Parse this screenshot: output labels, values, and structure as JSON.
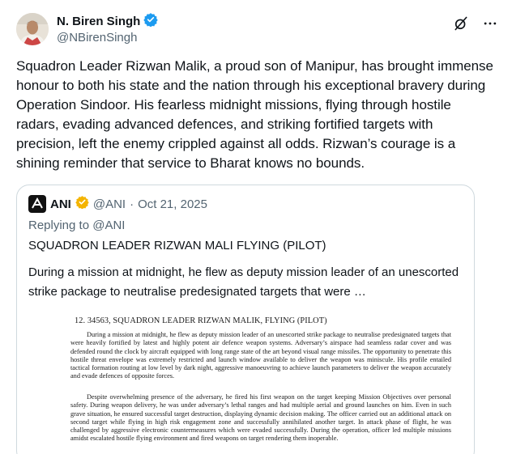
{
  "author": {
    "display_name": "N. Biren Singh",
    "handle": "@NBirenSingh",
    "verified_color": "#1d9bf0"
  },
  "actions": {
    "grok_icon": "grok-icon",
    "more_icon": "more-icon"
  },
  "tweet": {
    "text": "Squadron Leader Rizwan Malik, a proud son of Manipur, has brought immense honour to both his state and the nation through his exceptional bravery during Operation Sindoor. His fearless midnight missions, flying through hostile radars, evading advanced defences, and striking fortified targets with precision, left the enemy crippled against all odds. Rizwan’s courage is a shining reminder that service to Bharat knows no bounds."
  },
  "quote": {
    "name": "ANI",
    "handle": "@ANI",
    "separator": "·",
    "date": "Oct 21, 2025",
    "verified_color": "#f4b400",
    "replying_prefix": "Replying to ",
    "replying_handle": "@ANI",
    "title": "SQUADRON LEADER RIZWAN MALI FLYING (PILOT)",
    "body": "During a mission at midnight, he flew as deputy mission leader of an unescorted strike package to neutralise predesignated targets that were …",
    "document": {
      "heading": "12.  34563, SQUADRON LEADER RIZWAN MALIK, FLYING (PILOT)",
      "paragraph1": "During a mission at midnight, he flew as deputy mission leader of an unescorted strike package to neutralise predesignated targets that were heavily fortified by latest and highly potent air defence weapon systems. Adversary’s airspace had seamless radar cover and was defended round the clock by aircraft equipped with long range state of the art beyond visual range missiles. The opportunity to penetrate this hostile threat envelope was extremely restricted and launch window available to deliver the weapon was miniscule. His profile entailed tactical formation routing at low level by dark night, aggressive manoeuvring to achieve launch parameters to deliver the weapon accurately and evade defences of opposite forces.",
      "paragraph2": "Despite overwhelming presence of the adversary, he fired his first weapon on the target keeping Mission Objectives over personal safety. During weapon delivery, he was under adversary’s lethal ranges and had multiple aerial and ground launches on him. Even in such grave situation, he ensured successful target destruction, displaying dynamic decision making. The officer carried out an additional attack on second target while flying in high risk engagement zone and successfully annihilated another target. In attack phase of flight, he was challenged by aggressive electronic countermeasures which were evaded successfully. During the operation, officer led multiple missions amidst escalated hostile flying environment and fired weapons on target rendering them inoperable."
    }
  }
}
